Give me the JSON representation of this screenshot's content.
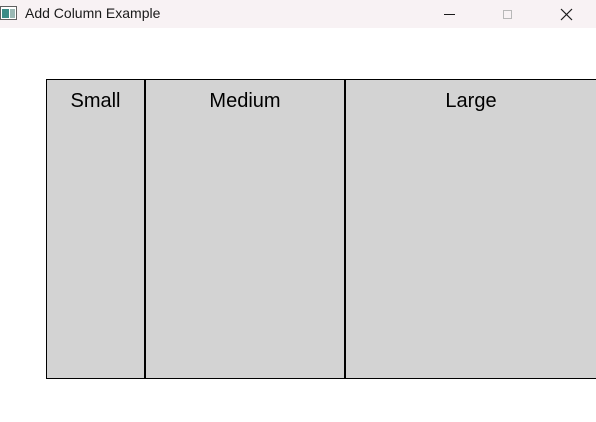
{
  "window": {
    "title": "Add Column Example",
    "icon": "app-window-icon"
  },
  "caption_buttons": {
    "minimize": "minimize-icon",
    "maximize": "maximize-icon",
    "close": "close-icon"
  },
  "columns": [
    {
      "label": "Small"
    },
    {
      "label": "Medium"
    },
    {
      "label": "Large"
    }
  ],
  "colors": {
    "column_background": "#d3d3d3",
    "border": "#000000",
    "titlebar": "#f8f2f4"
  }
}
